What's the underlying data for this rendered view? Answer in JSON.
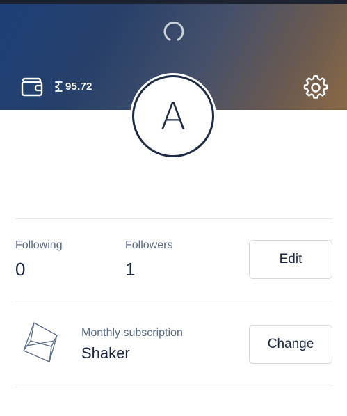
{
  "header": {
    "wallet_icon": "wallet-icon",
    "balance_icon": "coin-icon",
    "balance": "95.72",
    "loading_icon": "loading-spinner-icon",
    "settings_icon": "gear-icon",
    "gradient_start": "#1d3f78",
    "gradient_end": "#8a6a45"
  },
  "profile": {
    "avatar_letter": "A"
  },
  "stats": {
    "following_label": "Following",
    "following_count": "0",
    "followers_label": "Followers",
    "followers_count": "1",
    "edit_label": "Edit"
  },
  "subscription": {
    "icon": "cube-icon",
    "label": "Monthly subscription",
    "plan": "Shaker",
    "change_label": "Change"
  },
  "colors": {
    "text_primary": "#1a2540",
    "text_secondary": "#5a6b85",
    "divider": "#e6e8ec"
  }
}
